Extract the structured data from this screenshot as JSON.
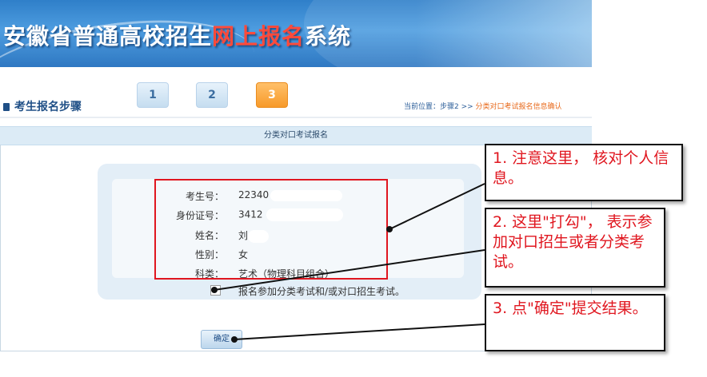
{
  "header": {
    "title_part1": "安徽省普通高校招生",
    "title_highlight": "网上报名",
    "title_part2": "系统"
  },
  "steps": {
    "label": "考生报名步骤",
    "items": [
      {
        "label": "1",
        "active": false
      },
      {
        "label": "2",
        "active": false
      },
      {
        "label": "3",
        "active": true
      }
    ],
    "breadcrumb_prefix": "当前位置：步骤2 >> ",
    "breadcrumb_current": "分类对口考试报名信息确认"
  },
  "section": {
    "title": "分类对口考试报名"
  },
  "info": {
    "rows": [
      {
        "label": "考生号：",
        "value": "22340"
      },
      {
        "label": "身份证号：",
        "value": "3412"
      },
      {
        "label": "姓名：",
        "value": "刘"
      },
      {
        "label": "性别：",
        "value": "女"
      },
      {
        "label": "科类：",
        "value": "艺术（物理科目组合）"
      }
    ]
  },
  "agreement": {
    "text": "报名参加分类考试和/或对口招生考试。"
  },
  "actions": {
    "confirm_label": "确定"
  },
  "callouts": [
    {
      "text": "1. 注意这里，  核对个人信息。"
    },
    {
      "text": "2. 这里\"打勾\"，  表示参加对口招生或者分类考试。"
    },
    {
      "text": "3. 点\"确定\"提交结果。"
    }
  ],
  "colors": {
    "accent_red": "#e0161f",
    "step_active": "#f79a2a",
    "header_blue": "#2f7fc9"
  }
}
